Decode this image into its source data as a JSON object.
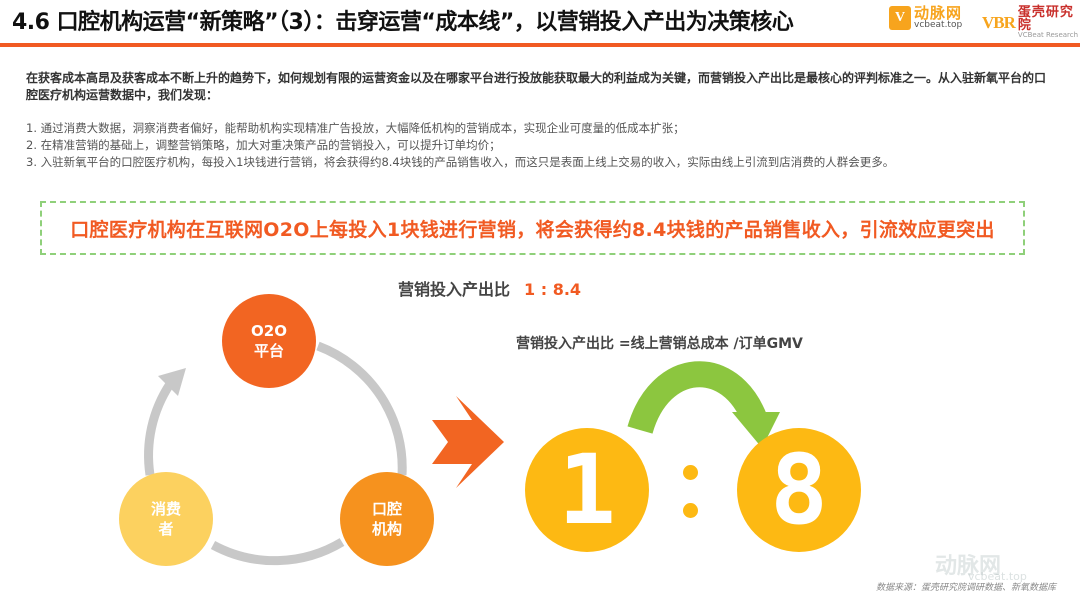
{
  "header": {
    "title": "4.6 口腔机构运营“新策略”（3）：击穿运营“成本线”，以营销投入产出为决策核心",
    "logo1_mark": "V",
    "logo1_name": "动脉网",
    "logo1_url": "vcbeat.top",
    "logo2_mark": "VBR",
    "logo2_name": "蛋壳研究院",
    "logo2_sub": "VCBeat Research"
  },
  "intro": "在获客成本高昂及获客成本不断上升的趋势下，如何规划有限的运营资金以及在哪家平台进行投放能获取最大的利益成为关键，而营销投入产出比是最核心的评判标准之一。从入驻新氧平台的口腔医疗机构运营数据中，我们发现：",
  "points": [
    "1.  通过消费大数据，洞察消费者偏好，能帮助机构实现精准广告投放，大幅降低机构的营销成本，实现企业可度量的低成本扩张；",
    "2.  在精准营销的基础上，调整营销策略，加大对重决策产品的营销投入，可以提升订单均价；",
    "3.  入驻新氧平台的口腔医疗机构，每投入1块钱进行营销，将会获得约8.4块钱的产品销售收入，而这只是表面上线上交易的收入，实际由线上引流到店消费的人群会更多。"
  ],
  "callout": "口腔医疗机构在互联网O2O上每投入1块钱进行营销，将会获得约8.4块钱的产品销售收入，引流效应更突出",
  "ratio": {
    "label": "营销投入产出比",
    "value": "1 : 8.4",
    "formula": "营销投入产出比 =线上营销总成本 /订单GMV"
  },
  "cycle": {
    "node1_line1": "O2O",
    "node1_line2": "平台",
    "node2_line1": "口腔",
    "node2_line2": "机构",
    "node3_line1": "消费",
    "node3_line2": "者"
  },
  "big_ratio": {
    "left": "1",
    "right": "8"
  },
  "colors": {
    "accent": "#f15a22",
    "o2o": "#f26522",
    "dental": "#f6921e",
    "consumer": "#fcd15f",
    "number": "#fdb913",
    "green_arrow": "#8cc63f",
    "callout_border": "#8fd07a"
  },
  "footer": {
    "source": "数据来源：蛋壳研究院调研数据、新氧数据库",
    "watermark": "动脉网",
    "watermark_url": "vcbeat.top"
  }
}
